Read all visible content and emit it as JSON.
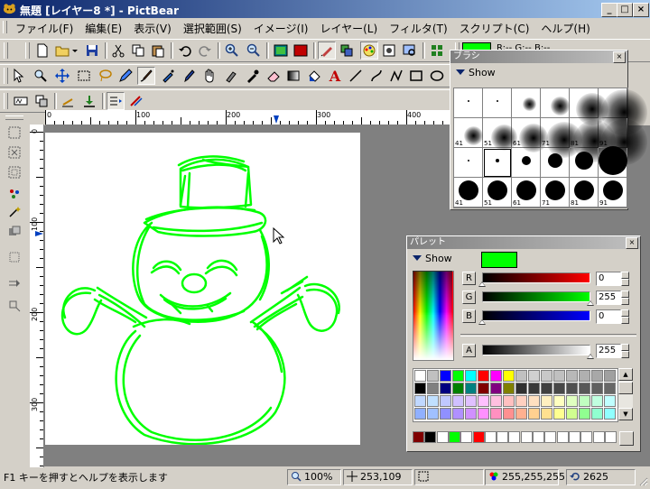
{
  "window": {
    "title": "無題 [レイヤー8 *] - PictBear",
    "min": "_",
    "max": "□",
    "close": "×"
  },
  "menu": [
    {
      "label": "ファイル(F)"
    },
    {
      "label": "編集(E)"
    },
    {
      "label": "表示(V)"
    },
    {
      "label": "選択範囲(S)"
    },
    {
      "label": "イメージ(I)"
    },
    {
      "label": "レイヤー(L)"
    },
    {
      "label": "フィルタ(T)"
    },
    {
      "label": "スクリプト(C)"
    },
    {
      "label": "ヘルプ(H)"
    }
  ],
  "color_readout": {
    "r": "R:--",
    "g": "G:--",
    "b": "B:--"
  },
  "colors": {
    "accent": "#0a246a",
    "paint": "#00ff00",
    "canvas": "#ffffff",
    "workspace": "#808080"
  },
  "rulers": {
    "h": [
      {
        "label": "0"
      },
      {
        "label": "100"
      },
      {
        "label": "200"
      },
      {
        "label": "300"
      },
      {
        "label": "400"
      }
    ],
    "v": [
      {
        "label": "0"
      },
      {
        "label": "100"
      },
      {
        "label": "200"
      },
      {
        "label": "300"
      }
    ]
  },
  "brush_panel": {
    "title": "ブラシ",
    "show_label": "Show",
    "labels": [
      "41",
      "51",
      "61",
      "71",
      "81",
      "91",
      "41",
      "51",
      "61",
      "71",
      "81",
      "91"
    ]
  },
  "palette_panel": {
    "title": "パレット",
    "show_label": "Show",
    "current_color": "#00ff00",
    "channels": [
      {
        "name": "R",
        "value": "0",
        "ratio": 0.0,
        "color": "#ff0000"
      },
      {
        "name": "G",
        "value": "255",
        "ratio": 1.0,
        "color": "#00ff00"
      },
      {
        "name": "B",
        "value": "0",
        "ratio": 0.0,
        "color": "#0000ff"
      }
    ],
    "alpha": {
      "name": "A",
      "value": "255",
      "ratio": 1.0
    },
    "swatches_row1": [
      "#ffffff",
      "#c0c0c0",
      "#0000ff",
      "#00ff00",
      "#00ffff",
      "#ff0000",
      "#ff00ff",
      "#ffff00",
      "#c0c0c0",
      "#d0d0d0",
      "#c8c8c8",
      "#c0c0c0",
      "#b8b8b8",
      "#b0b0b0",
      "#a8a8a8",
      "#a0a0a0"
    ],
    "swatches_row2": [
      "#000000",
      "#808080",
      "#000080",
      "#008000",
      "#008080",
      "#800000",
      "#800080",
      "#808000",
      "#303030",
      "#383838",
      "#404040",
      "#484848",
      "#505050",
      "#585858",
      "#606060",
      "#686868"
    ],
    "swatches_row3": [
      "#c0d8ff",
      "#c0e0ff",
      "#c0c8ff",
      "#d0c0ff",
      "#e0c0ff",
      "#ffc0ff",
      "#ffc0e0",
      "#ffc0c0",
      "#ffd0c0",
      "#ffe0c0",
      "#fff0c0",
      "#ffffc0",
      "#e0ffc0",
      "#c0ffc0",
      "#c0ffe0",
      "#c0ffff"
    ],
    "swatches_row4": [
      "#90b0ff",
      "#a0c0ff",
      "#9090ff",
      "#b090ff",
      "#d090ff",
      "#ff90ff",
      "#ff90c0",
      "#ff9090",
      "#ffb090",
      "#ffd090",
      "#ffe090",
      "#ffff90",
      "#d0ff90",
      "#90ff90",
      "#90ffd0",
      "#90ffff"
    ],
    "recent": [
      "#800000",
      "#000000",
      "#ffffff",
      "#00ff00",
      "#ffffff",
      "#ff0000",
      "#ffffff",
      "#ffffff",
      "#ffffff",
      "#ffffff",
      "#ffffff",
      "#ffffff",
      "#ffffff",
      "#ffffff",
      "#ffffff",
      "#ffffff",
      "#ffffff"
    ]
  },
  "status": {
    "help": "F1 キーを押すとヘルプを表示します",
    "zoom": "100%",
    "coords": "253,109",
    "rgb": "255,255,255",
    "history": "2625"
  }
}
